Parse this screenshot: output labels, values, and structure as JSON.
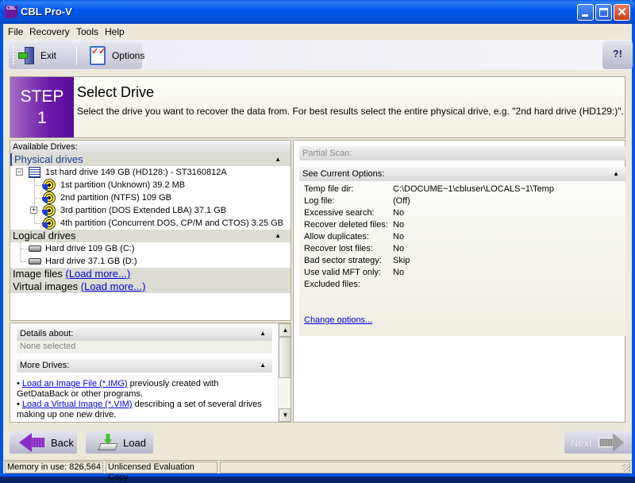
{
  "window": {
    "title": "CBL Pro-V",
    "logo_text": "CBL",
    "controls": {
      "minimize": "minimize",
      "maximize": "maximize",
      "close": "✕"
    }
  },
  "menu": [
    {
      "label": "File",
      "accel": "F"
    },
    {
      "label": "Recovery",
      "accel": "R"
    },
    {
      "label": "Tools",
      "accel": "T"
    },
    {
      "label": "Help",
      "accel": "H"
    }
  ],
  "toolbar": {
    "exit_label": "Exit",
    "options_label": "Options",
    "options_icon_glyph": "✓✓",
    "help_icon_glyph": "?!"
  },
  "step": {
    "badge_line1": "STEP",
    "badge_line2": "1",
    "title": "Select Drive",
    "description": "Select the drive you want to recover the data from. For best results select the entire physical drive, e.g. \"2nd hard drive (HD129:)\"."
  },
  "drives": {
    "section_label": "Available Drives:",
    "physical_title": "Physical drives",
    "physical": {
      "drive": "1st hard drive 149 GB (HD128:) - ST3160812A",
      "partitions": [
        {
          "label": "1st partition (Unknown) 39.2 MB",
          "expandable": false
        },
        {
          "label": "2nd partition (NTFS) 109 GB",
          "expandable": false
        },
        {
          "label": "3rd partition (DOS Extended LBA) 37.1 GB",
          "expandable": true
        },
        {
          "label": "4th partition (Concurrent DOS, CP/M and CTOS) 3.25 GB",
          "expandable": false
        }
      ]
    },
    "logical_title": "Logical drives",
    "logical": [
      {
        "label": "Hard drive 109 GB (C:)"
      },
      {
        "label": "Hard drive 37.1 GB (D:)"
      }
    ],
    "image_files_label": "Image files",
    "image_files_link": "(Load more...)",
    "virtual_images_label": "Virtual images",
    "virtual_images_link": "(Load more...)",
    "collapse_glyph": "▲",
    "expand_minus": "−",
    "expand_plus": "+"
  },
  "details": {
    "title": "Details about:",
    "value": "None selected",
    "more_title": "More Drives:",
    "more_items": [
      {
        "link": "Load an Image File (*.IMG)",
        "text": " previously created with GetDataBack or other programs."
      },
      {
        "link": "Load a Virtual Image (*.VIM)",
        "text": " describing a set of several drives making up one new drive."
      }
    ],
    "scroll_up": "▲",
    "scroll_down": "▼"
  },
  "options": {
    "partial_scan_label": "Partial Scan:",
    "current_title": "See Current Options:",
    "rows": [
      {
        "key": "Temp file dir:",
        "value": "C:\\DOCUME~1\\cbluser\\LOCALS~1\\Temp"
      },
      {
        "key": "Log file:",
        "value": "(Off)"
      },
      {
        "key": "Excessive search:",
        "value": "No"
      },
      {
        "key": "Recover deleted files:",
        "value": "No"
      },
      {
        "key": "Allow duplicates:",
        "value": "No"
      },
      {
        "key": "Recover lost files:",
        "value": "No"
      },
      {
        "key": "Bad sector strategy:",
        "value": "Skip"
      },
      {
        "key": "Use valid MFT only:",
        "value": "No"
      },
      {
        "key": "Excluded files:",
        "value": ""
      }
    ],
    "change_link": "Change options..."
  },
  "nav": {
    "back_label": "Back",
    "load_label": "Load",
    "next_label": "Next",
    "next_enabled": false
  },
  "status": {
    "memory": "Memory in use: 826,564",
    "license": "Unlicensed Evaluation Copy",
    "empty": ""
  }
}
